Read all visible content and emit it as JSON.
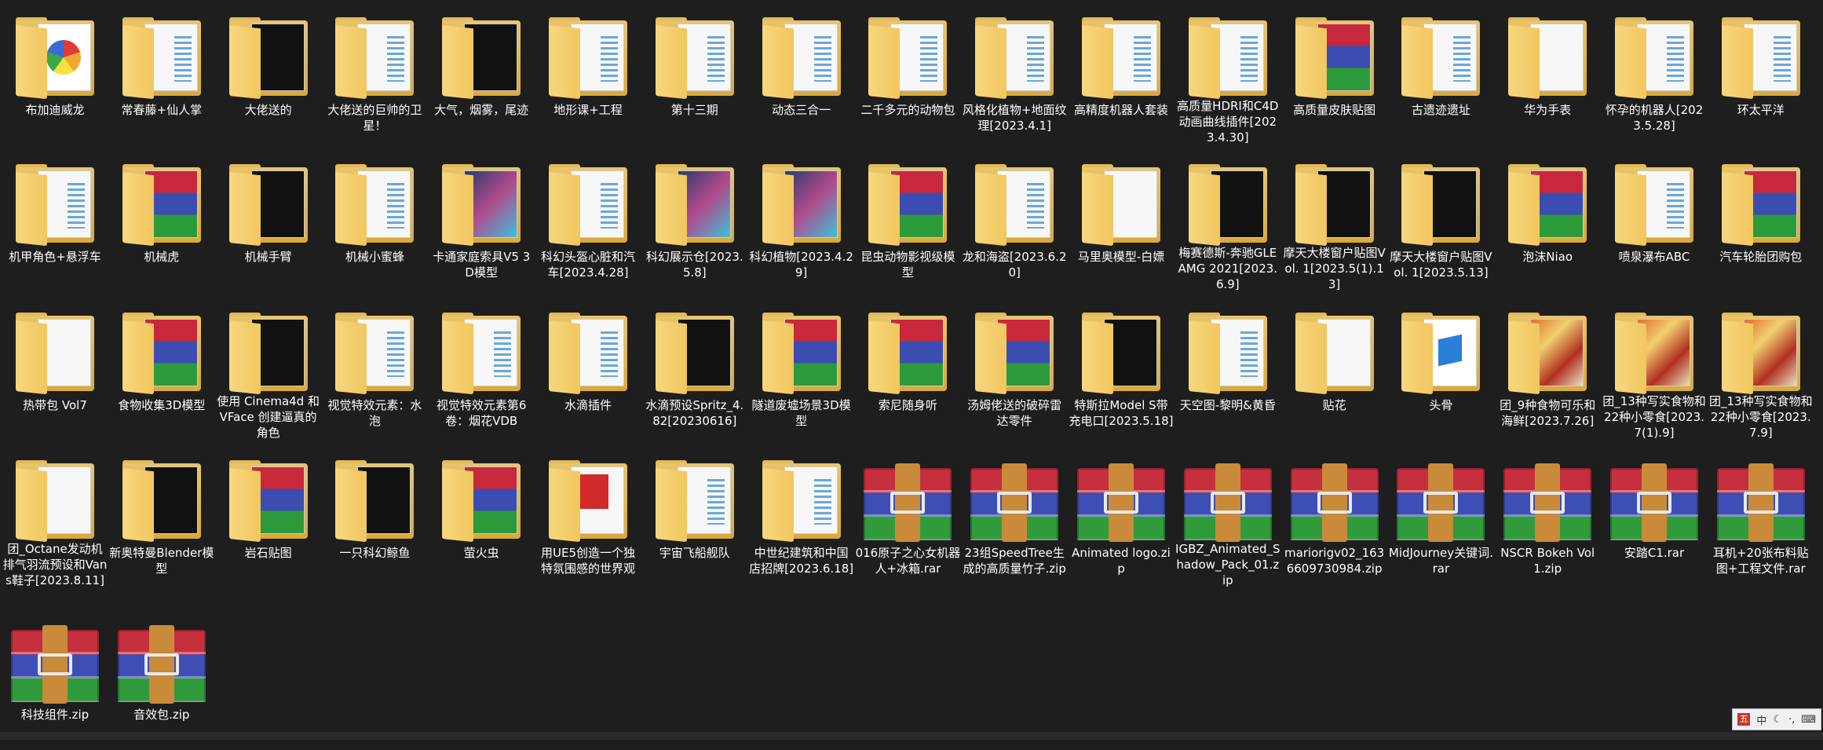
{
  "rows": [
    [
      {
        "name": "布加迪威龙",
        "type": "folder",
        "preview": "wheel"
      },
      {
        "name": "常春藤+仙人掌",
        "type": "folder",
        "preview": "docs"
      },
      {
        "name": "大佬送的",
        "type": "folder",
        "preview": "dark"
      },
      {
        "name": "大佬送的巨帅的卫星！",
        "type": "folder",
        "preview": "docs"
      },
      {
        "name": "大气，烟雾，尾迹",
        "type": "folder",
        "preview": "dark"
      },
      {
        "name": "地形课+工程",
        "type": "folder",
        "preview": "docs"
      },
      {
        "name": "第十三期",
        "type": "folder",
        "preview": "docs"
      },
      {
        "name": "动态三合一",
        "type": "folder",
        "preview": "docs"
      },
      {
        "name": "二千多元的动物包",
        "type": "folder",
        "preview": "docs"
      },
      {
        "name": "风格化植物+地面纹理[2023.4.1]",
        "type": "folder",
        "preview": "docs"
      },
      {
        "name": "高精度机器人套装",
        "type": "folder",
        "preview": "docs"
      },
      {
        "name": "高质量HDRI和C4D动画曲线插件[2023.4.30]",
        "type": "folder",
        "preview": "docs"
      },
      {
        "name": "高质量皮肤贴图",
        "type": "folder",
        "preview": "rar"
      },
      {
        "name": "古遗迹遗址",
        "type": "folder",
        "preview": "docs"
      },
      {
        "name": "华为手表",
        "type": "folder",
        "preview": "blank"
      },
      {
        "name": "怀孕的机器人[2023.5.28]",
        "type": "folder",
        "preview": "docs"
      },
      {
        "name": "环太平洋",
        "type": "folder",
        "preview": "docs"
      }
    ],
    [
      {
        "name": "机甲角色+悬浮车",
        "type": "folder",
        "preview": "docs"
      },
      {
        "name": "机械虎",
        "type": "folder",
        "preview": "rar"
      },
      {
        "name": "机械手臂",
        "type": "folder",
        "preview": "dark"
      },
      {
        "name": "机械小蜜蜂",
        "type": "folder",
        "preview": "docs"
      },
      {
        "name": "卡通家庭索具V5 3D模型",
        "type": "folder",
        "preview": "photo"
      },
      {
        "name": "科幻头盔心脏和汽车[2023.4.28]",
        "type": "folder",
        "preview": "docs"
      },
      {
        "name": "科幻展示仓[2023.5.8]",
        "type": "folder",
        "preview": "photo"
      },
      {
        "name": "科幻植物[2023.4.29]",
        "type": "folder",
        "preview": "photo"
      },
      {
        "name": "昆虫动物影视级模型",
        "type": "folder",
        "preview": "rar"
      },
      {
        "name": "龙和海盗[2023.6.20]",
        "type": "folder",
        "preview": "docs"
      },
      {
        "name": "马里奥模型-白嫖",
        "type": "folder",
        "preview": "blank"
      },
      {
        "name": "梅赛德斯-奔驰GLE AMG 2021[2023.6.9]",
        "type": "folder",
        "preview": "dark"
      },
      {
        "name": "摩天大楼窗户贴图Vol. 1[2023.5(1).13]",
        "type": "folder",
        "preview": "dark"
      },
      {
        "name": "摩天大楼窗户贴图Vol. 1[2023.5.13]",
        "type": "folder",
        "preview": "dark"
      },
      {
        "name": "泡沫Niao",
        "type": "folder",
        "preview": "rar"
      },
      {
        "name": "喷泉瀑布ABC",
        "type": "folder",
        "preview": "docs"
      },
      {
        "name": "汽车轮胎团购包",
        "type": "folder",
        "preview": "rar"
      }
    ],
    [
      {
        "name": "热带包 Vol7",
        "type": "folder",
        "preview": "blank"
      },
      {
        "name": "食物收集3D模型",
        "type": "folder",
        "preview": "rar"
      },
      {
        "name": "使用 Cinema4d 和 VFace 创建逼真的角色",
        "type": "folder",
        "preview": "dark"
      },
      {
        "name": "视觉特效元素：水泡",
        "type": "folder",
        "preview": "docs"
      },
      {
        "name": "视觉特效元素第6卷：烟花VDB",
        "type": "folder",
        "preview": "docs"
      },
      {
        "name": "水滴插件",
        "type": "folder",
        "preview": "docs"
      },
      {
        "name": "水滴预设Spritz_4.82[20230616]",
        "type": "folder",
        "preview": "dark"
      },
      {
        "name": "隧道废墟场景3D模型",
        "type": "folder",
        "preview": "rar"
      },
      {
        "name": "索尼随身听",
        "type": "folder",
        "preview": "rar"
      },
      {
        "name": "汤姆佬送的破碎雷达零件",
        "type": "folder",
        "preview": "rar"
      },
      {
        "name": "特斯拉Model S带充电口[2023.5.18]",
        "type": "folder",
        "preview": "dark"
      },
      {
        "name": "天空图-黎明&黄昏",
        "type": "folder",
        "preview": "docs"
      },
      {
        "name": "贴花",
        "type": "folder",
        "preview": "blank"
      },
      {
        "name": "头骨",
        "type": "folder",
        "preview": "blue"
      },
      {
        "name": "团_9种食物可乐和海鲜[2023.7.26]",
        "type": "folder",
        "preview": "food"
      },
      {
        "name": "团_13种写实食物和22种小零食[2023.7(1).9]",
        "type": "folder",
        "preview": "food"
      },
      {
        "name": "团_13种写实食物和22种小零食[2023.7.9]",
        "type": "folder",
        "preview": "food"
      }
    ],
    [
      {
        "name": "团_Octane发动机排气羽流预设和Vans鞋子[2023.8.11]",
        "type": "folder",
        "preview": "blank"
      },
      {
        "name": "新奥特曼Blender模型",
        "type": "folder",
        "preview": "dark"
      },
      {
        "name": "岩石贴图",
        "type": "folder",
        "preview": "rar"
      },
      {
        "name": "一只科幻鲸鱼",
        "type": "folder",
        "preview": "dark"
      },
      {
        "name": "萤火虫",
        "type": "folder",
        "preview": "rar"
      },
      {
        "name": "用UE5创造一个独特氛围感的世界观",
        "type": "folder",
        "preview": "red"
      },
      {
        "name": "宇宙飞船舰队",
        "type": "folder",
        "preview": "docs"
      },
      {
        "name": "中世纪建筑和中国店招牌[2023.6.18]",
        "type": "folder",
        "preview": "docs"
      },
      {
        "name": "016原子之心女机器人+冰箱.rar",
        "type": "archive"
      },
      {
        "name": "23组SpeedTree生成的高质量竹子.zip",
        "type": "archive"
      },
      {
        "name": "Animated logo.zip",
        "type": "archive"
      },
      {
        "name": "IGBZ_Animated_Shadow_Pack_01.zip",
        "type": "archive"
      },
      {
        "name": "mariorigv02_1636609730984.zip",
        "type": "archive"
      },
      {
        "name": "MidJourney关键词.rar",
        "type": "archive"
      },
      {
        "name": "NSCR Bokeh Vol 1.zip",
        "type": "archive"
      },
      {
        "name": "安踏C1.rar",
        "type": "archive"
      },
      {
        "name": "耳机+20张布料贴图+工程文件.rar",
        "type": "archive"
      }
    ],
    [
      {
        "name": "科技组件.zip",
        "type": "archive"
      },
      {
        "name": "音效包.zip",
        "type": "archive"
      }
    ]
  ],
  "tray": {
    "ime_icon": "ime-icon",
    "mode_label": "中",
    "moon_icon": "moon-icon",
    "punct_label": "·,",
    "settings_icon": "keyboard-icon"
  }
}
